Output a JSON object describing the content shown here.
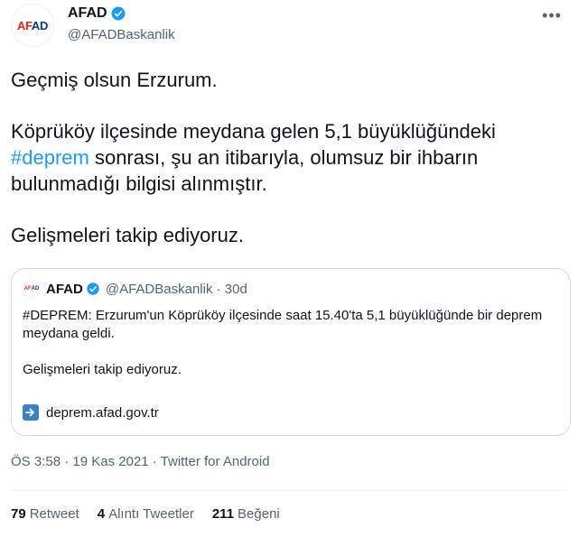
{
  "author": {
    "name": "AFAD",
    "handle": "@AFADBaskanlik",
    "avatar_text_a": "AF",
    "avatar_text_b": "AD"
  },
  "tweet": {
    "line1": "Geçmiş olsun Erzurum.",
    "para2_before": "Köprüköy ilçesinde meydana gelen 5,1 büyüklüğündeki ",
    "hashtag": "#deprem",
    "para2_after": " sonrası, şu an itibarıyla, olumsuz bir ihbarın bulunmadığı bilgisi alınmıştır.",
    "line3": "Gelişmeleri takip ediyoruz."
  },
  "quote": {
    "name": "AFAD",
    "handle_time": "@AFADBaskanlik · 30d",
    "text1": "#DEPREM: Erzurum'un Köprüköy ilçesinde saat 15.40'ta 5,1 büyüklüğünde bir deprem meydana geldi.",
    "text2": "Gelişmeleri takip ediyoruz.",
    "link": "deprem.afad.gov.tr"
  },
  "meta": "ÖS 3:58 · 19 Kas 2021 · Twitter for Android",
  "stats": {
    "retweets": "79",
    "retweets_label": "Retweet",
    "quotes": "4",
    "quotes_label": "Alıntı Tweetler",
    "likes": "211",
    "likes_label": "Beğeni"
  },
  "colors": {
    "accent": "#1d9bf0",
    "secondary_text": "#536471",
    "border": "#cfd9de"
  },
  "icons": [
    "verified-badge-icon",
    "more-icon",
    "link-arrow-icon"
  ]
}
